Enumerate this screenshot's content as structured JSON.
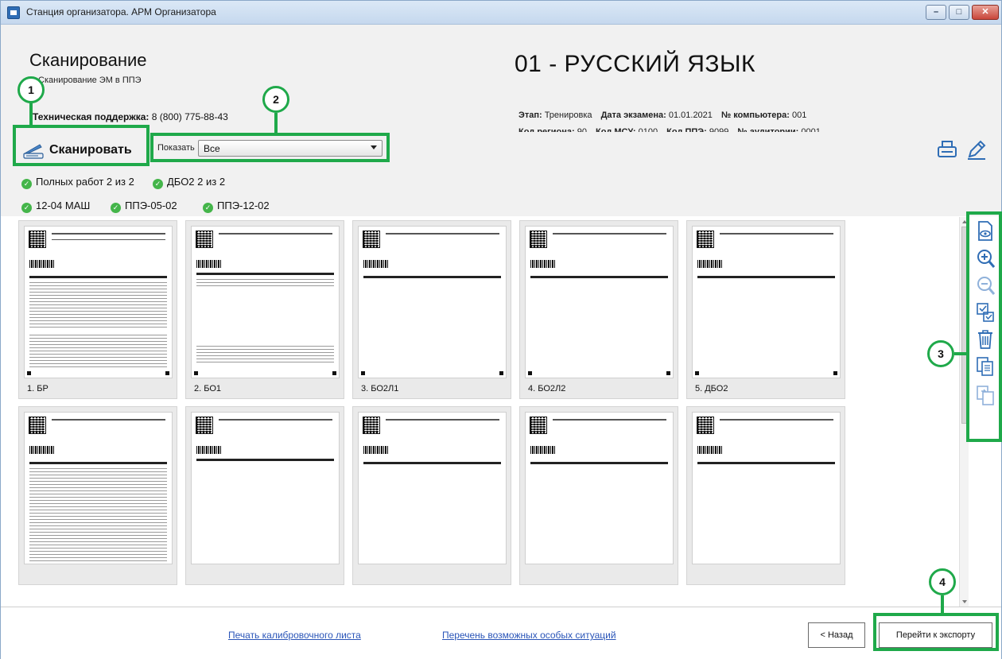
{
  "window": {
    "title": "Станция организатора. АРМ Организатора",
    "minimize": "–",
    "maximize": "□",
    "close": "✕"
  },
  "header": {
    "title": "Сканирование",
    "subtitle": "Сканирование ЭМ в ППЭ",
    "support_label": "Техническая поддержка:",
    "support_value": "8 (800) 775-88-43",
    "subject": "01 - РУССКИЙ ЯЗЫК",
    "stage_label": "Этап:",
    "stage_value": "Тренировка",
    "exam_date_label": "Дата экзамена:",
    "exam_date_value": "01.01.2021",
    "computer_label": "№ компьютера:",
    "computer_value": "001",
    "region_label": "Код региона:",
    "region_value": "90",
    "msu_label": "Код МСУ:",
    "msu_value": "0100",
    "ppe_label": "Код ППЭ:",
    "ppe_value": "9099",
    "auditorium_label": "№ аудитории:",
    "auditorium_value": "0001"
  },
  "toolbar": {
    "scan_label": "Сканировать",
    "show_label": "Показать",
    "show_value": "Все"
  },
  "status": {
    "badges_row1": [
      "Полных работ 2 из 2",
      "ДБО2 2 из 2"
    ],
    "badges_row2": [
      "12-04 МАШ",
      "ППЭ-05-02",
      "ППЭ-12-02"
    ]
  },
  "thumbnails": {
    "row1": [
      "1. БР",
      "2. БО1",
      "3. БО2Л1",
      "4. БО2Л2",
      "5. ДБО2"
    ],
    "row2": [
      "",
      "",
      "",
      "",
      ""
    ]
  },
  "right_tools": [
    "view-page-icon",
    "zoom-in-icon",
    "zoom-out-icon",
    "check-pages-icon",
    "delete-icon",
    "copy-pages-icon",
    "replace-page-icon"
  ],
  "footer": {
    "calibration_link": "Печать калибровочного листа",
    "situations_link": "Перечень возможных особых ситуаций",
    "back_button": "< Назад",
    "export_button": "Перейти к экспорту"
  },
  "annotations": {
    "marker1": "1",
    "marker2": "2",
    "marker3": "3",
    "marker4": "4"
  },
  "colors": {
    "highlight": "#1fa94a",
    "link": "#2a55b8",
    "check": "#44b54a",
    "panel": "#f1f1f1"
  }
}
